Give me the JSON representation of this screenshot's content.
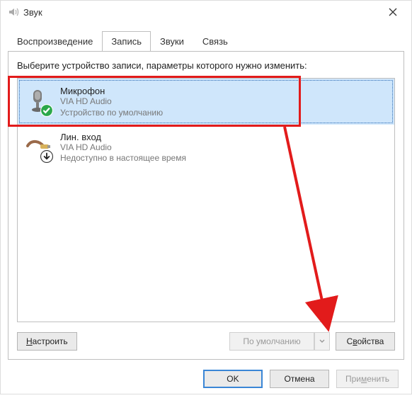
{
  "window": {
    "title": "Звук"
  },
  "tabs": {
    "items": [
      {
        "label": "Воспроизведение"
      },
      {
        "label": "Запись"
      },
      {
        "label": "Звуки"
      },
      {
        "label": "Связь"
      }
    ],
    "active_index": 1
  },
  "instruction": "Выберите устройство записи, параметры которого нужно изменить:",
  "devices": [
    {
      "title": "Микрофон",
      "sub": "VIA HD Audio",
      "status": "Устройство по умолчанию",
      "icon": "microphone",
      "badge": "check-green",
      "selected": true
    },
    {
      "title": "Лин. вход",
      "sub": "VIA HD Audio",
      "status": "Недоступно в настоящее время",
      "icon": "line-in",
      "badge": "down-arrow",
      "selected": false
    }
  ],
  "panel_buttons": {
    "configure": "Настроить",
    "default_dd": "По умолчанию",
    "properties": "Свойства"
  },
  "dialog_buttons": {
    "ok": "OK",
    "cancel": "Отмена",
    "apply": "Применить"
  }
}
